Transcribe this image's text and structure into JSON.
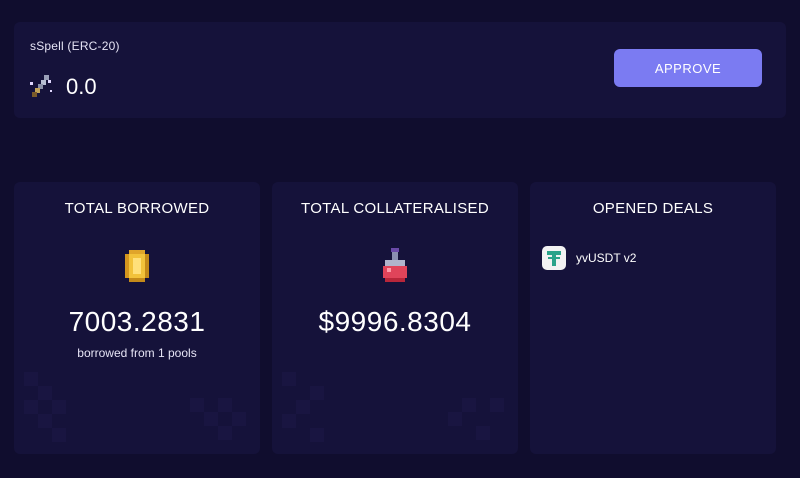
{
  "token": {
    "name": "sSpell (ERC-20)",
    "balance": "0.0",
    "icon": "spell-token-icon"
  },
  "actions": {
    "approve_label": "APPROVE"
  },
  "cards": {
    "total_borrowed": {
      "title": "TOTAL BORROWED",
      "value": "7003.2831",
      "subtitle": "borrowed from 1 pools",
      "icon": "gold-coin-icon"
    },
    "total_collateralised": {
      "title": "TOTAL COLLATERALISED",
      "value": "$9996.8304",
      "icon": "potion-flask-icon"
    },
    "opened_deals": {
      "title": "OPENED DEALS",
      "items": [
        {
          "label": "yvUSDT v2",
          "icon": "tether-icon"
        }
      ]
    }
  },
  "colors": {
    "background": "#100d2e",
    "panel": "#15123a",
    "accent": "#7b7bf2",
    "text": "#ffffff"
  }
}
